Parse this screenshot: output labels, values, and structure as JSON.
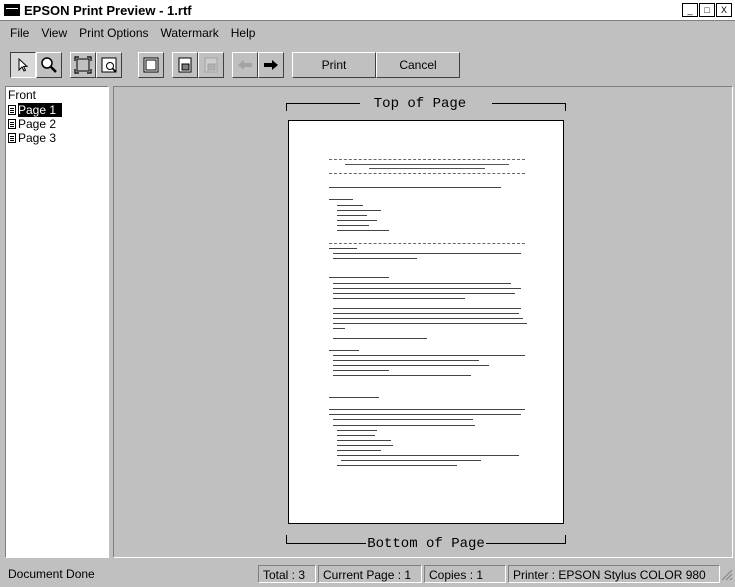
{
  "window": {
    "title": "EPSON Print Preview - 1.rtf",
    "minimize": "_",
    "maximize": "□",
    "close": "X"
  },
  "menu": [
    "File",
    "View",
    "Print Options",
    "Watermark",
    "Help"
  ],
  "toolbar": {
    "print_label": "Print",
    "cancel_label": "Cancel"
  },
  "sidebar": {
    "header": "Front",
    "items": [
      "Page 1",
      "Page 2",
      "Page 3"
    ],
    "selected": 0
  },
  "preview": {
    "top_label": "Top of Page",
    "bottom_label": "Bottom of Page"
  },
  "status": {
    "message": "Document Done",
    "total": "Total : 3",
    "current_page": "Current Page : 1",
    "copies": "Copies : 1",
    "printer": "Printer : EPSON Stylus COLOR 980"
  }
}
